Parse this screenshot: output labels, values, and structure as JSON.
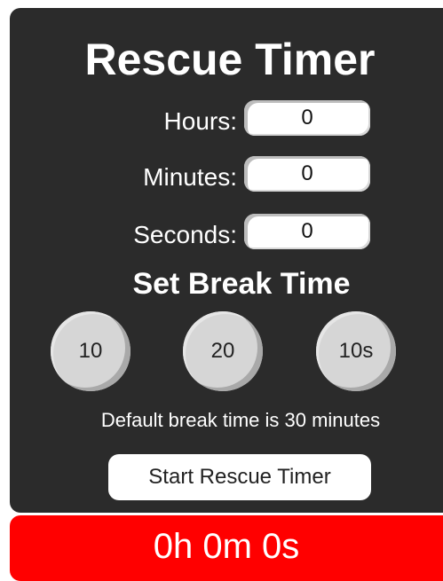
{
  "app": {
    "title": "Rescue Timer"
  },
  "inputs": {
    "hours": {
      "label": "Hours:",
      "value": "0"
    },
    "minutes": {
      "label": "Minutes:",
      "value": "0"
    },
    "seconds": {
      "label": "Seconds:",
      "value": "0"
    }
  },
  "break": {
    "title": "Set Break Time",
    "options": [
      "10",
      "20",
      "10s"
    ],
    "default_note": "Default break time is 30 minutes"
  },
  "start_button": {
    "label": "Start Rescue Timer"
  },
  "display": {
    "text": "0h 0m 0s"
  },
  "colors": {
    "panel": "#2b2b2b",
    "display_bg": "#ff0000",
    "break_button": "#d6d6d6",
    "text_light": "#ffffff"
  }
}
